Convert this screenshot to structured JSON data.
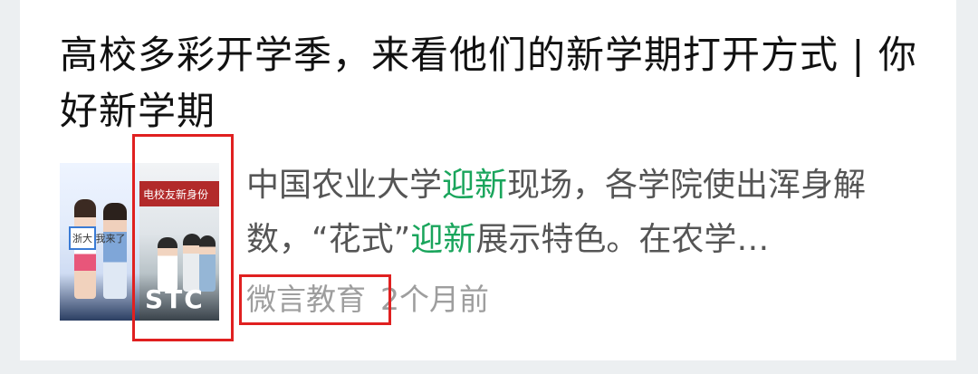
{
  "article": {
    "title": "高校多彩开学季，来看他们的新学期打开方式 | 你好新学期",
    "summary": {
      "part1": "中国农业大学",
      "keyword1": "迎新",
      "part2": "现场，各学院使出浑身解数，“花式”",
      "keyword2": "迎新",
      "part3": "展示特色。在农学…"
    },
    "source": "微言教育",
    "time": "2个月前",
    "thumbnail": {
      "banner_text": "电校友新身份",
      "overlay_text": "STC",
      "sign_text": "浙大 我来了"
    }
  },
  "colors": {
    "keyword": "#1aa55c",
    "highlight_box": "#e02020",
    "title": "#111111",
    "summary": "#555555",
    "meta": "#9e9e9e"
  }
}
